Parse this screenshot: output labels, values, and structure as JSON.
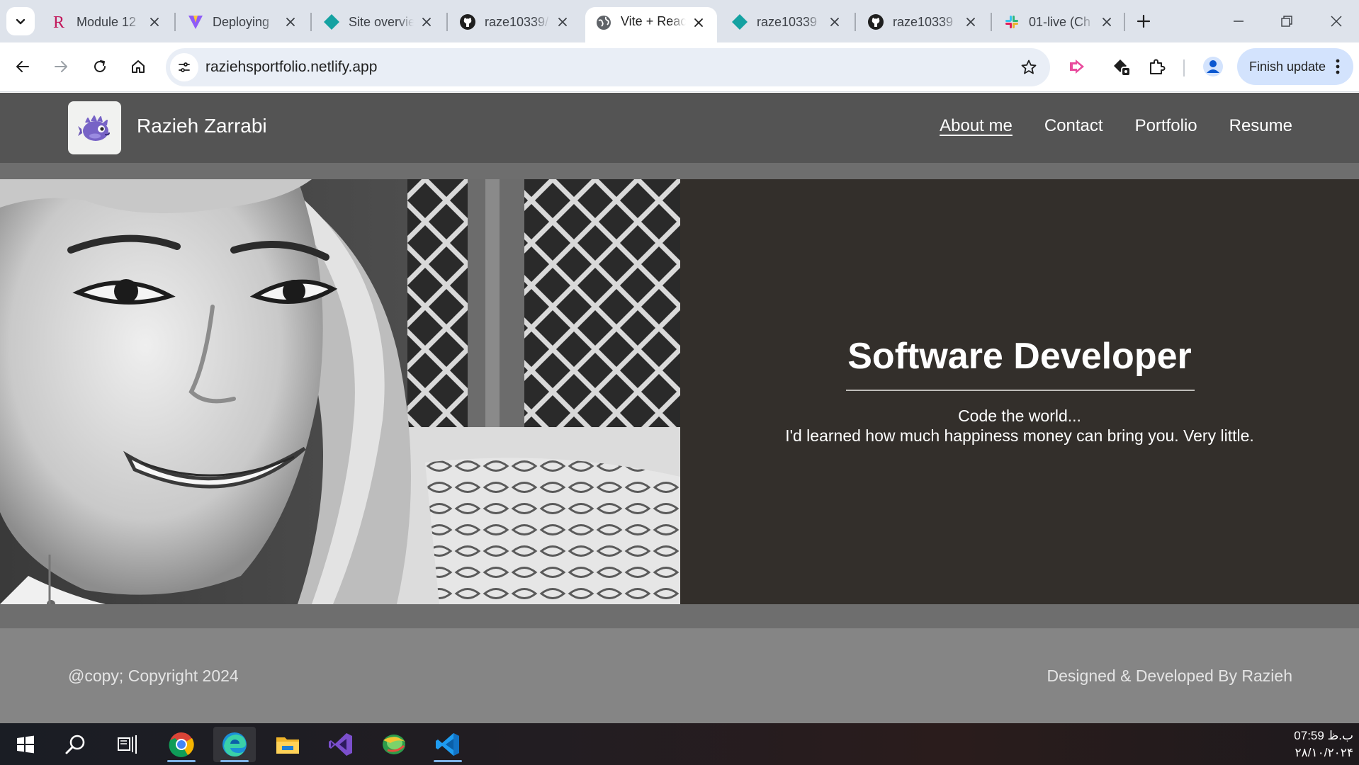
{
  "browser": {
    "tabs": [
      {
        "title": "Module 12",
        "favicon": "r-logo-icon",
        "active": false
      },
      {
        "title": "Deploying",
        "favicon": "vite-logo-icon",
        "active": false
      },
      {
        "title": "Site overview",
        "favicon": "netlify-logo-icon",
        "active": false
      },
      {
        "title": "raze10339/",
        "favicon": "github-logo-icon",
        "active": false
      },
      {
        "title": "Vite + React",
        "favicon": "globe-icon",
        "active": true
      },
      {
        "title": "raze10339",
        "favicon": "netlify-logo-icon",
        "active": false
      },
      {
        "title": "raze10339",
        "favicon": "github-logo-icon",
        "active": false
      },
      {
        "title": "01-live (Ch",
        "favicon": "slack-logo-icon",
        "active": false
      }
    ],
    "url": "raziehsportfolio.netlify.app",
    "finish_update_label": "Finish update",
    "colors": {
      "tabstrip": "#dee3eb",
      "omnibox": "#e9eef6",
      "update_pill": "#d3e3fd"
    }
  },
  "site": {
    "name": "Razieh Zarrabi",
    "nav": [
      {
        "label": "About me",
        "active": true
      },
      {
        "label": "Contact",
        "active": false
      },
      {
        "label": "Portfolio",
        "active": false
      },
      {
        "label": "Resume",
        "active": false
      }
    ],
    "hero": {
      "title": "Software Developer",
      "tagline_1": "Code the world...",
      "tagline_2": "I'd learned how much happiness money can bring you. Very little."
    },
    "footer": {
      "copyright": "@copy; Copyright 2024",
      "credit": "Designed & Developed By Razieh"
    },
    "colors": {
      "header": "#545454",
      "band": "#6e6e6e",
      "hero_text_bg": "#332f2b",
      "footer": "#858585"
    }
  },
  "taskbar": {
    "apps": [
      "windows-start-icon",
      "search-icon",
      "task-view-icon",
      "chrome-icon",
      "edge-icon",
      "file-explorer-icon",
      "visual-studio-icon",
      "download-manager-icon",
      "vscode-icon"
    ],
    "time": "07:59 ب.ظ",
    "date": "۲۸/۱۰/۲۰۲۴"
  }
}
